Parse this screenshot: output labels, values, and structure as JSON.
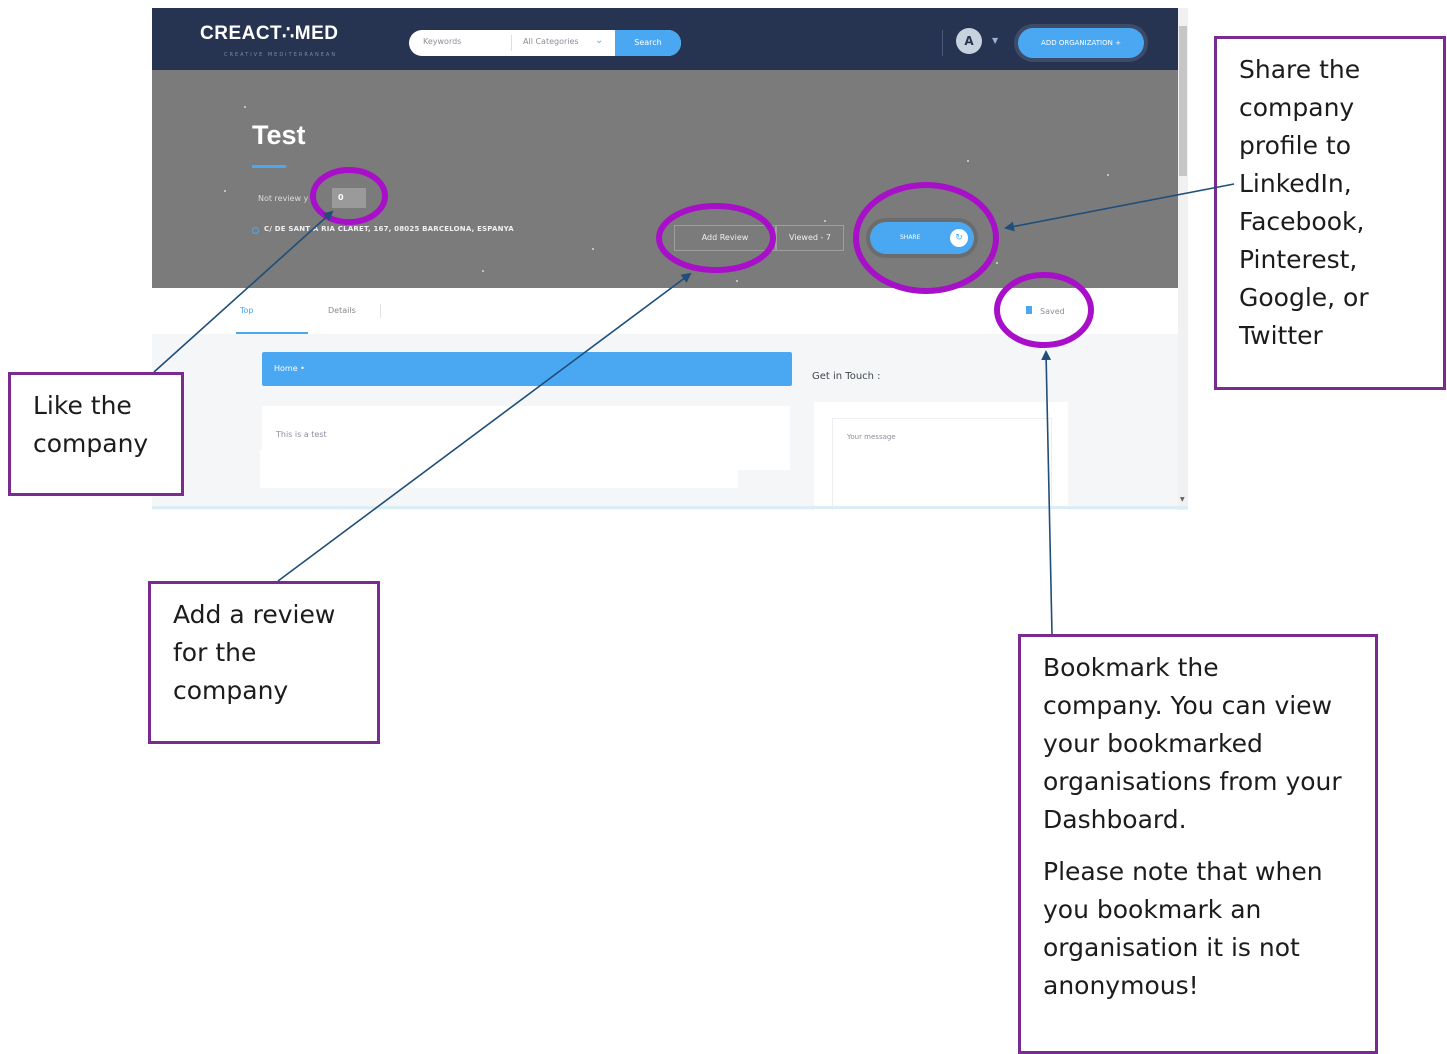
{
  "app": {
    "logo": "CREACT∴MED",
    "logo_tagline": "CREATIVE MEDITERRANEAN"
  },
  "header": {
    "search_placeholder": "Keywords",
    "category_select": "All Categories",
    "search_button": "Search",
    "lang_icon": "language-icon",
    "add_org_button": "ADD ORGANIZATION +"
  },
  "hero": {
    "title": "Test",
    "rating_label": "Not review y",
    "like_count": "0",
    "address": "C/ DE SANT A          RIA CLARET, 167, 08025 BARCELONA, ESPANYA",
    "add_review": "Add Review",
    "viewed": "Viewed - 7",
    "share": "SHARE",
    "share_icon": "share-icon"
  },
  "tabs": {
    "items": [
      "Top",
      "Details"
    ],
    "saved": "Saved",
    "saved_icon": "bookmark-icon"
  },
  "main": {
    "breadcrumb": "Home •",
    "content": "This is a test",
    "get_in_touch": "Get in Touch :",
    "message_placeholder": "Your message"
  },
  "annotations": {
    "share": [
      "Share the",
      "company",
      "profile to",
      "LinkedIn,",
      "Facebook,",
      "Pinterest,",
      "Google, or",
      "Twitter"
    ],
    "like": [
      "Like the",
      "company"
    ],
    "review": [
      "Add a review",
      "for the",
      "company"
    ],
    "bookmark_p1": [
      "Bookmark the",
      "company. You can view",
      "your bookmarked",
      "organisations from your",
      "Dashboard."
    ],
    "bookmark_p2": [
      "Please note that when",
      "you bookmark an",
      "organisation it is not",
      "anonymous!"
    ]
  },
  "colors": {
    "accent": "#4aa8f3",
    "navbar": "#263451",
    "hero": "#7b7b7b",
    "highlight": "#a80fc8",
    "arrow": "#1f4e79",
    "note_border": "#7a2b8f"
  }
}
